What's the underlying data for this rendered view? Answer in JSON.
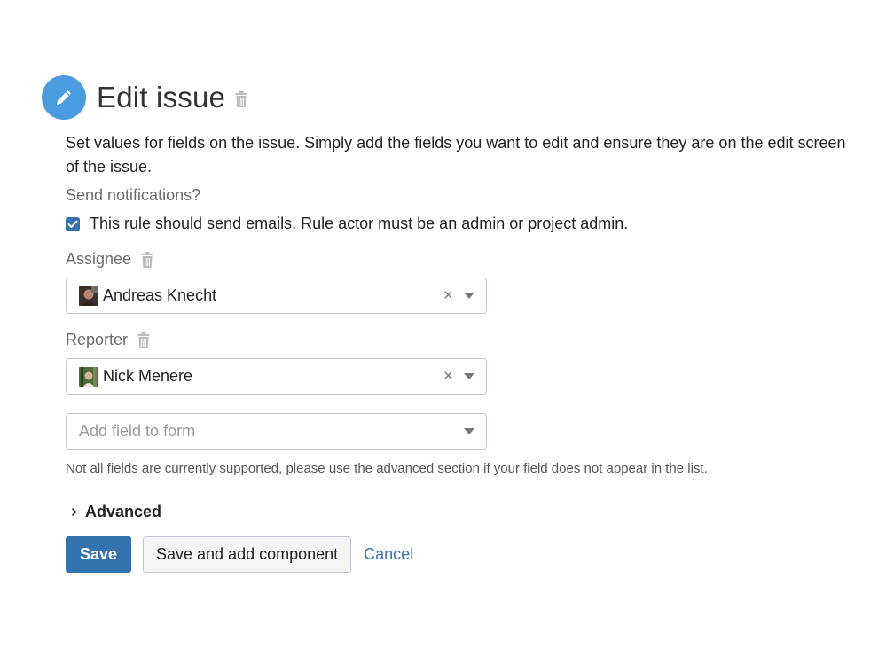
{
  "header": {
    "title": "Edit issue",
    "icon": "pencil-icon",
    "icon_bg": "#4a9be0"
  },
  "description": "Set values for fields on the issue. Simply add the fields you want to edit and ensure they are on the edit screen of the issue.",
  "notifications": {
    "label": "Send notifications?",
    "checkbox_label": "This rule should send emails. Rule actor must be an admin or project admin.",
    "checked": true
  },
  "fields": {
    "assignee": {
      "label": "Assignee",
      "value": "Andreas Knecht"
    },
    "reporter": {
      "label": "Reporter",
      "value": "Nick Menere"
    }
  },
  "add_field": {
    "placeholder": "Add field to form"
  },
  "help_text": "Not all fields are currently supported, please use the advanced section if your field does not appear in the list.",
  "advanced": {
    "label": "Advanced"
  },
  "buttons": {
    "save": "Save",
    "save_and_add": "Save and add component",
    "cancel": "Cancel"
  },
  "colors": {
    "primary": "#3572b0",
    "link": "#3572b0"
  }
}
